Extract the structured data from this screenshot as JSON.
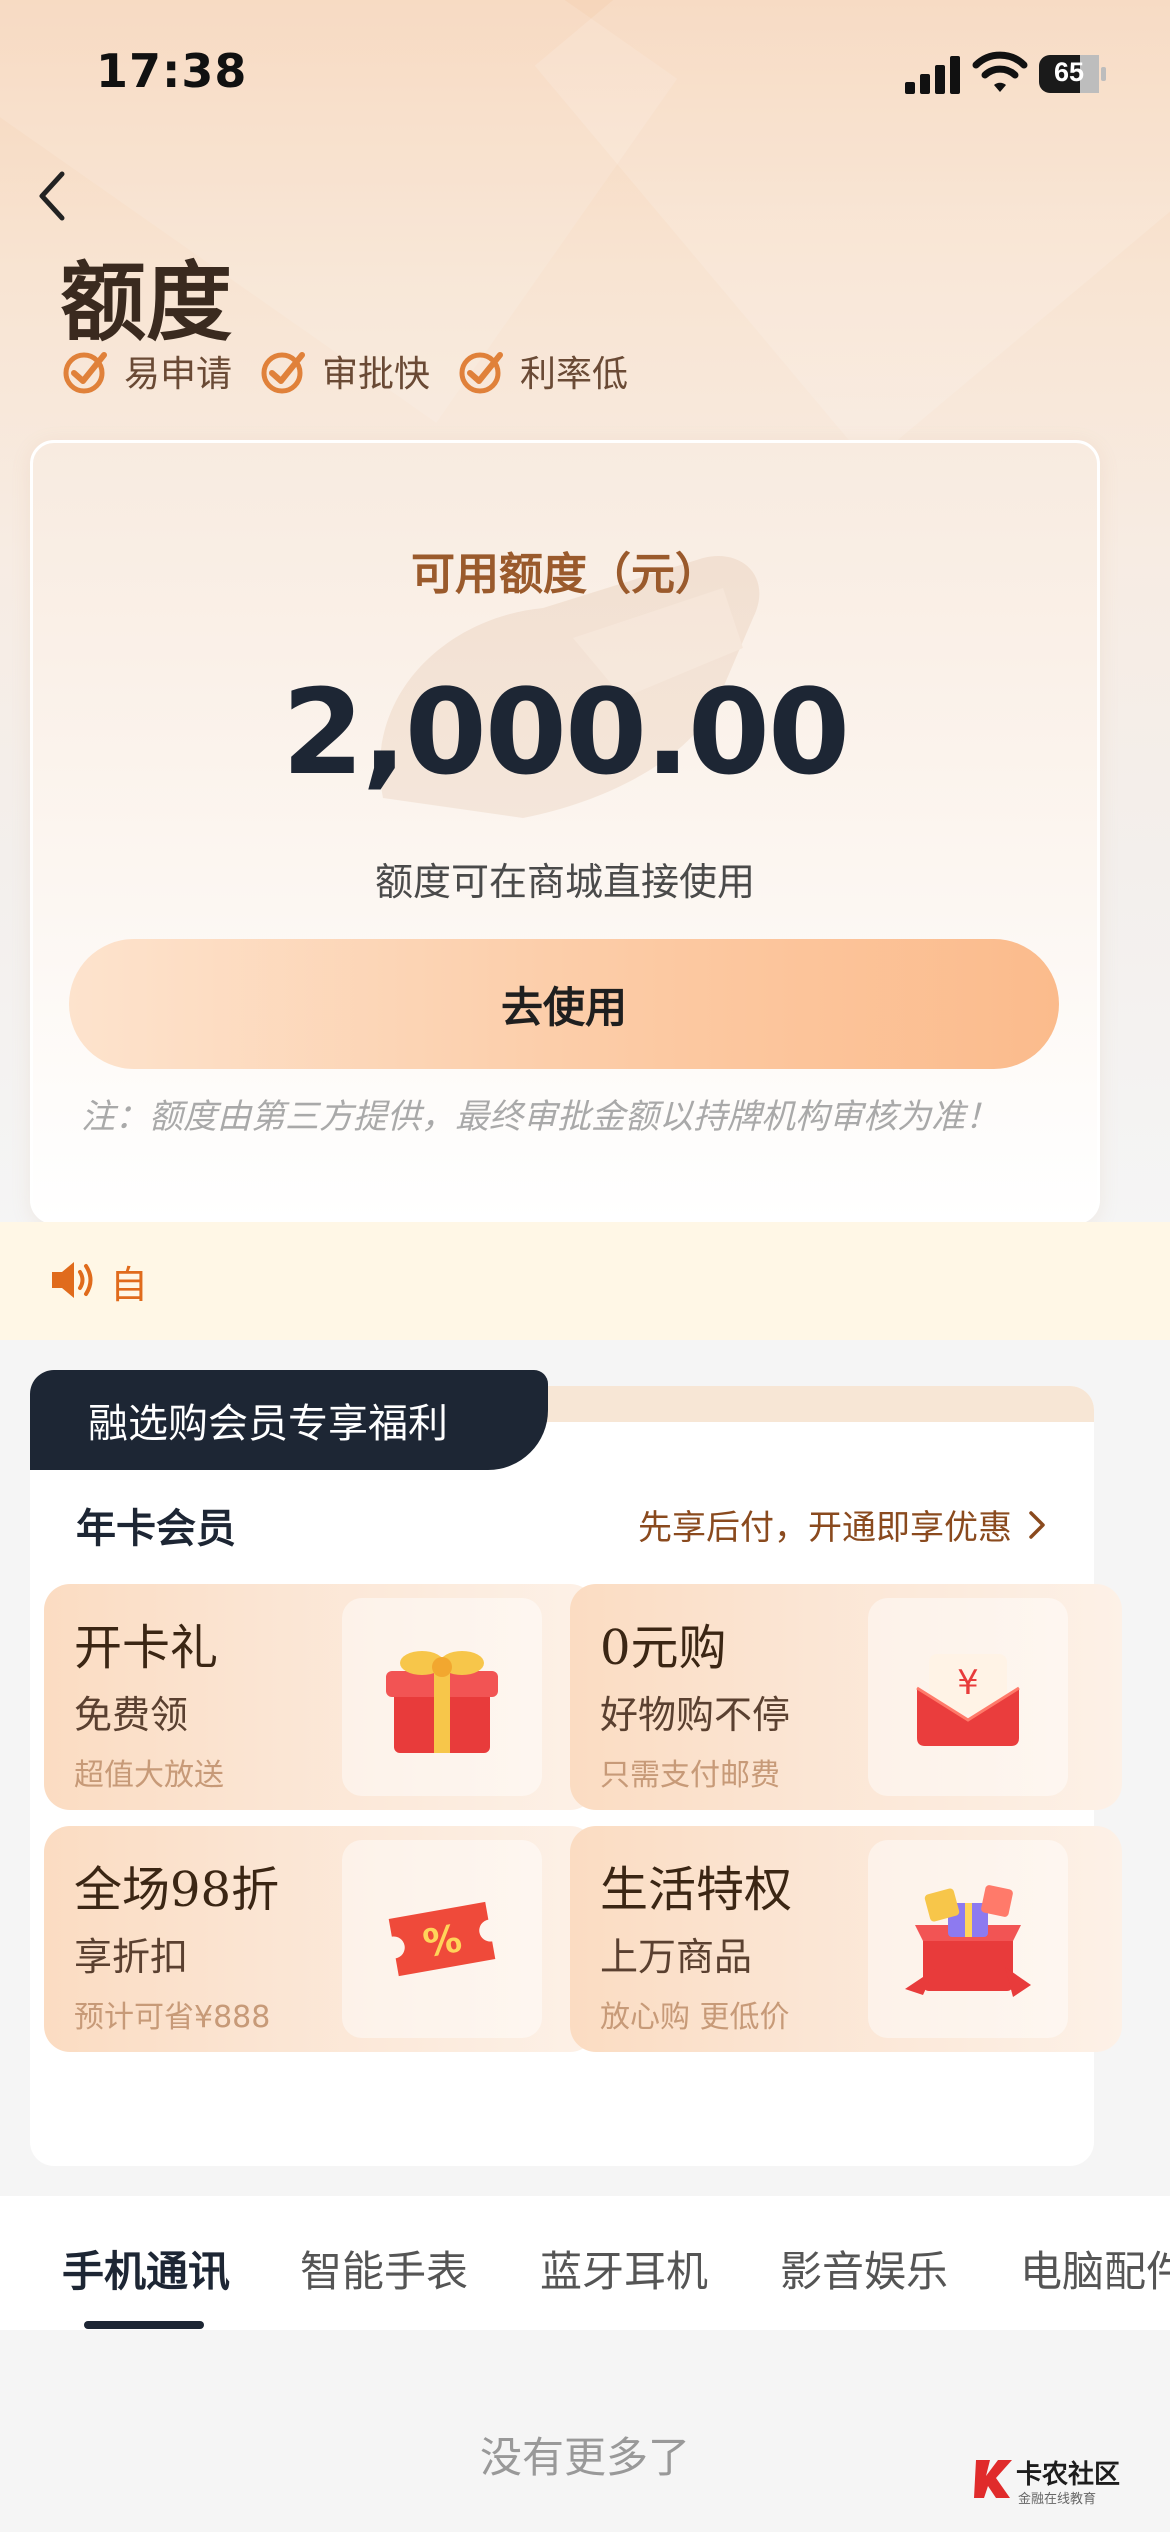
{
  "status_bar": {
    "time": "17:38",
    "battery": "65"
  },
  "header": {
    "title": "额度"
  },
  "tags": [
    {
      "label": "易申请"
    },
    {
      "label": "审批快"
    },
    {
      "label": "利率低"
    }
  ],
  "credit": {
    "label": "可用额度（元）",
    "amount": "2,000.00",
    "subtitle": "额度可在商城直接使用",
    "button": "去使用",
    "disclaimer": "注：额度由第三方提供，最终审批金额以持牌机构审核为准！"
  },
  "notice": {
    "text": "自"
  },
  "benefits": {
    "tab": "融选购会员专享福利",
    "annual_title": "年卡会员",
    "annual_link": "先享后付，开通即享优惠",
    "cards": [
      {
        "title": "开卡礼",
        "subtitle": "免费领",
        "note": "超值大放送",
        "icon": "gift-box-icon"
      },
      {
        "title": "0元购",
        "subtitle": "好物购不停",
        "note": "只需支付邮费",
        "icon": "red-envelope-icon"
      },
      {
        "title": "全场98折",
        "subtitle": "享折扣",
        "note": "预计可省¥888",
        "icon": "discount-ticket-icon"
      },
      {
        "title": "生活特权",
        "subtitle": "上万商品",
        "note": "放心购 更低价",
        "icon": "gift-pile-icon"
      }
    ]
  },
  "categories": [
    {
      "label": "手机通讯",
      "active": true
    },
    {
      "label": "智能手表",
      "active": false
    },
    {
      "label": "蓝牙耳机",
      "active": false
    },
    {
      "label": "影音娱乐",
      "active": false
    },
    {
      "label": "电脑配件",
      "active": false
    }
  ],
  "footer": {
    "no_more": "没有更多了"
  },
  "watermark": {
    "title": "卡农社区",
    "subtitle": "金融在线教育"
  },
  "colors": {
    "accent": "#e06b1c",
    "dark": "#1d2634",
    "button_gradient_end": "#fbbb8c"
  }
}
